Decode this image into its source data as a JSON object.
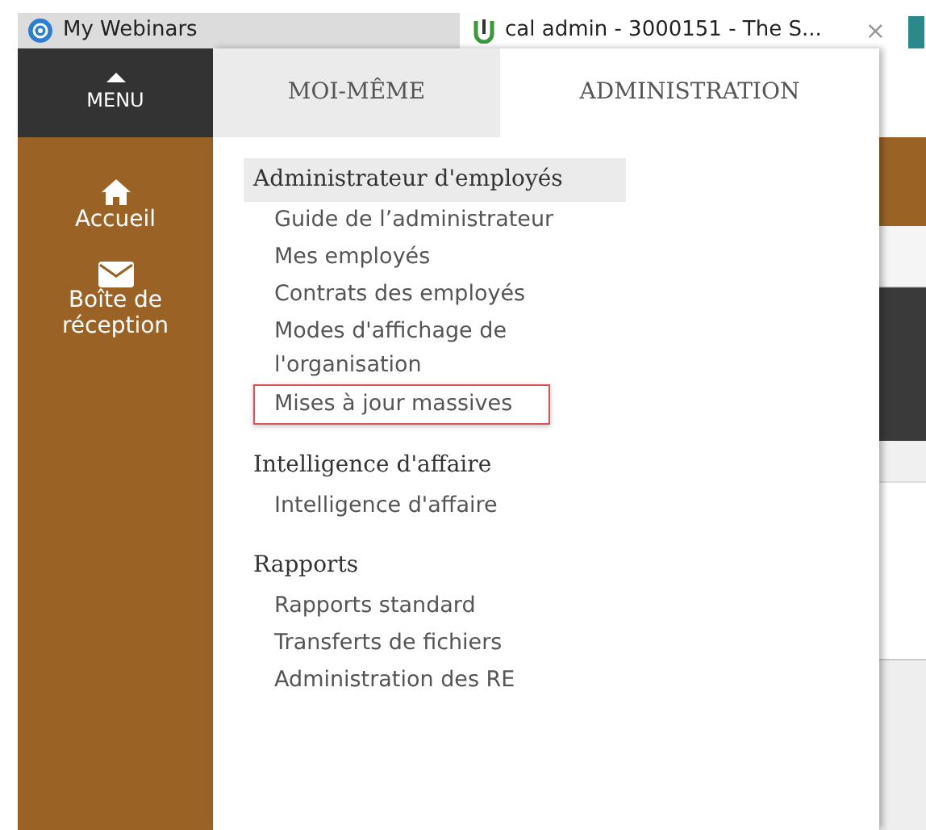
{
  "browser_tabs": [
    {
      "title": "My Webinars",
      "selected": false
    },
    {
      "title": "cal admin - 3000151 - The S...",
      "selected": true,
      "close": "×"
    }
  ],
  "menu": {
    "label": "MENU"
  },
  "sidebar": {
    "items": [
      {
        "label": "Accueil",
        "kind": "home"
      },
      {
        "label": "Boîte de réception",
        "kind": "mail"
      }
    ]
  },
  "tabs": [
    {
      "label": "MOI-MÊME",
      "selected": false
    },
    {
      "label": "ADMINISTRATION",
      "selected": true
    }
  ],
  "sections": [
    {
      "heading": "Administrateur d'employés",
      "selected": true,
      "items": [
        {
          "label": "Guide de l’administrateur",
          "highlighted": false
        },
        {
          "label": "Mes employés",
          "highlighted": false
        },
        {
          "label": "Contrats des employés",
          "highlighted": false
        },
        {
          "label": "Modes d'affichage de l'organisation",
          "highlighted": false
        },
        {
          "label": "Mises à jour massives",
          "highlighted": true
        }
      ]
    },
    {
      "heading": "Intelligence d'affaire",
      "selected": false,
      "items": [
        {
          "label": "Intelligence d'affaire",
          "highlighted": false
        }
      ]
    },
    {
      "heading": "Rapports",
      "selected": false,
      "items": [
        {
          "label": "Rapports standard",
          "highlighted": false
        },
        {
          "label": "Transferts de fichiers",
          "highlighted": false
        },
        {
          "label": "Administration des RE",
          "highlighted": false
        }
      ]
    }
  ]
}
